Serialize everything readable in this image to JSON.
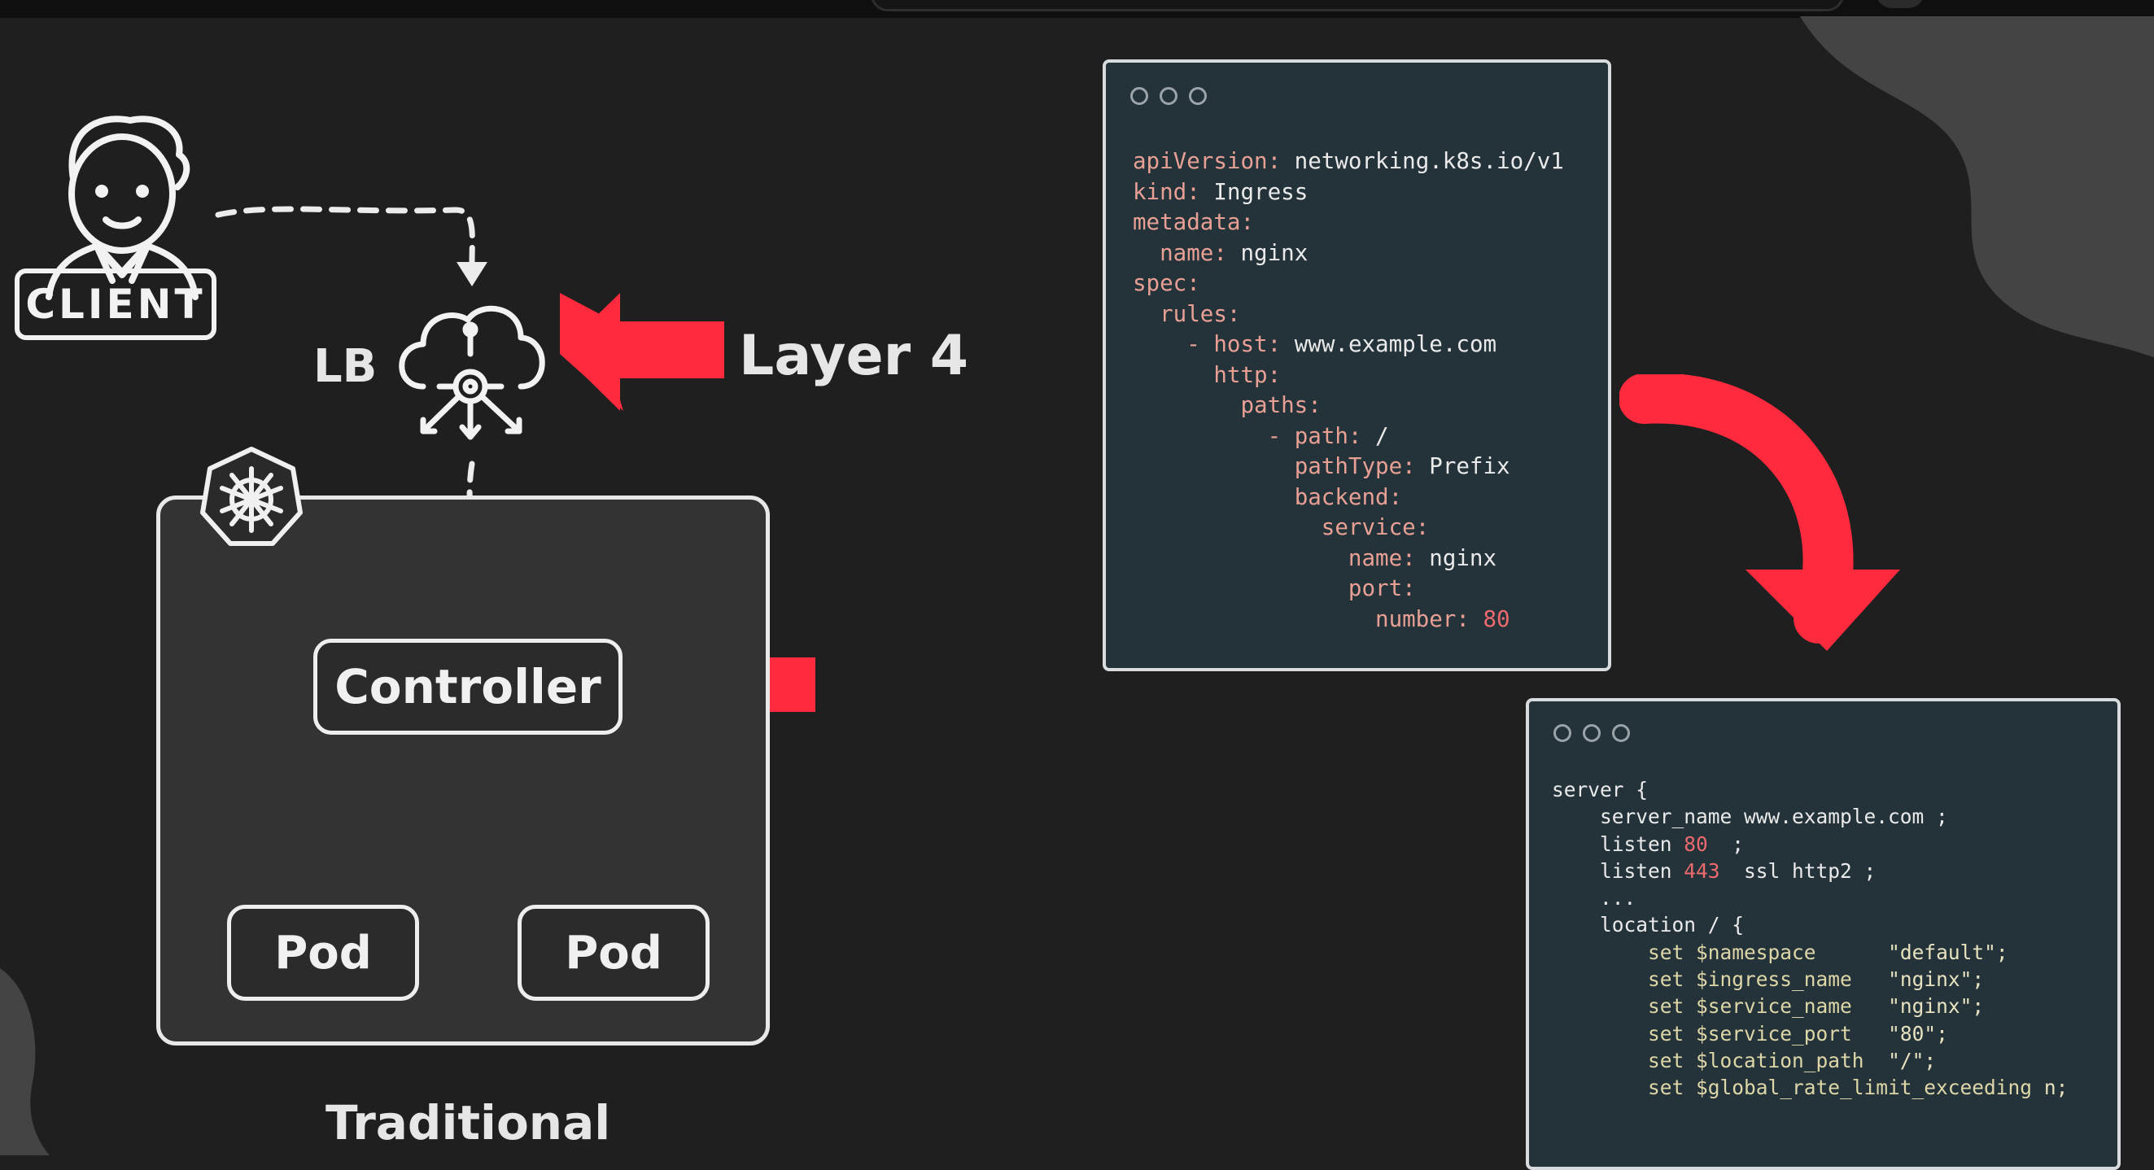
{
  "diagram": {
    "client_label": "CLIENT",
    "lb_label": "LB",
    "layer_label": "Layer 4",
    "controller_label": "Controller",
    "pod_label_1": "Pod",
    "pod_label_2": "Pod",
    "caption": "Traditional"
  },
  "ingress_yaml": [
    {
      "indent": 0,
      "key": "apiVersion",
      "value": "networking.k8s.io/v1"
    },
    {
      "indent": 0,
      "key": "kind",
      "value": "Ingress"
    },
    {
      "indent": 0,
      "key": "metadata",
      "value": ""
    },
    {
      "indent": 1,
      "key": "name",
      "value": "nginx"
    },
    {
      "indent": 0,
      "key": "spec",
      "value": ""
    },
    {
      "indent": 1,
      "key": "rules",
      "value": ""
    },
    {
      "indent": 2,
      "dash": true,
      "key": "host",
      "value": "www.example.com"
    },
    {
      "indent": 3,
      "key": "http",
      "value": ""
    },
    {
      "indent": 4,
      "key": "paths",
      "value": ""
    },
    {
      "indent": 5,
      "dash": true,
      "key": "path",
      "value": "/"
    },
    {
      "indent": 6,
      "key": "pathType",
      "value": "Prefix"
    },
    {
      "indent": 6,
      "key": "backend",
      "value": ""
    },
    {
      "indent": 7,
      "key": "service",
      "value": ""
    },
    {
      "indent": 8,
      "key": "name",
      "value": "nginx"
    },
    {
      "indent": 8,
      "key": "port",
      "value": ""
    },
    {
      "indent": 9,
      "key": "number",
      "value": "80",
      "numeric": true
    }
  ],
  "nginx_conf": [
    {
      "text": "server {"
    },
    {
      "text": "    server_name www.example.com ;"
    },
    {
      "text": "    listen ",
      "num": "80",
      "rest": "  ;"
    },
    {
      "text": "    listen ",
      "num": "443",
      "rest": "  ssl http2 ;"
    },
    {
      "text": "    ..."
    },
    {
      "text": "    location / {"
    },
    {
      "set": true,
      "var": "$namespace",
      "pad": "      ",
      "val": "\"default\";"
    },
    {
      "set": true,
      "var": "$ingress_name",
      "pad": "   ",
      "val": "\"nginx\";"
    },
    {
      "set": true,
      "var": "$service_name",
      "pad": "   ",
      "val": "\"nginx\";"
    },
    {
      "set": true,
      "var": "$service_port",
      "pad": "   ",
      "val": "\"80\";"
    },
    {
      "set": true,
      "var": "$location_path",
      "pad": "  ",
      "val": "\"/\";"
    },
    {
      "set": true,
      "var": "$global_rate_limit_exceeding",
      "pad": " ",
      "val": "n;"
    }
  ],
  "colors": {
    "accent_arrow": "#ff2a3d",
    "code_bg": "#243239",
    "yaml_key": "#e8a095",
    "number": "#ec6a6e"
  },
  "icons": [
    "client-person-icon",
    "cloud-load-balancer-icon",
    "kubernetes-helm-icon",
    "window-dots-icon"
  ]
}
